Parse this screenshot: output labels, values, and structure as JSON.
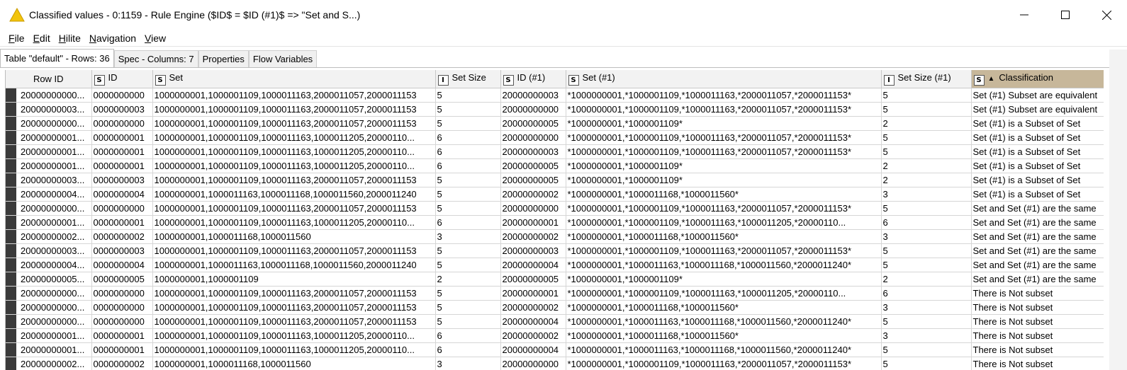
{
  "window": {
    "title": "Classified values - 0:1159 - Rule Engine ($ID$ = $ID (#1)$ => \"Set and S...)"
  },
  "menu": [
    "File",
    "Edit",
    "Hilite",
    "Navigation",
    "View"
  ],
  "tabs": [
    {
      "label": "Table \"default\" - Rows: 36",
      "active": true
    },
    {
      "label": "Spec - Columns: 7",
      "active": false
    },
    {
      "label": "Properties",
      "active": false
    },
    {
      "label": "Flow Variables",
      "active": false
    }
  ],
  "table": {
    "columns": [
      {
        "label": "Row ID",
        "type": ""
      },
      {
        "label": "ID",
        "type": "S"
      },
      {
        "label": "Set",
        "type": "S"
      },
      {
        "label": "Set Size",
        "type": "I"
      },
      {
        "label": "ID (#1)",
        "type": "S"
      },
      {
        "label": "Set (#1)",
        "type": "S"
      },
      {
        "label": "Set Size (#1)",
        "type": "I"
      },
      {
        "label": "Classification",
        "type": "S",
        "sorted": true
      }
    ],
    "rows": [
      [
        "20000000000...",
        "0000000000",
        "1000000001,1000001109,1000011163,2000011057,2000011153",
        "5",
        "20000000003",
        "*1000000001,*1000001109,*1000011163,*2000011057,*2000011153*",
        "5",
        "Set (#1) Subset are equivalent"
      ],
      [
        "20000000003...",
        "0000000003",
        "1000000001,1000001109,1000011163,2000011057,2000011153",
        "5",
        "20000000000",
        "*1000000001,*1000001109,*1000011163,*2000011057,*2000011153*",
        "5",
        "Set (#1) Subset are equivalent"
      ],
      [
        "20000000000...",
        "0000000000",
        "1000000001,1000001109,1000011163,2000011057,2000011153",
        "5",
        "20000000005",
        "*1000000001,*1000001109*",
        "2",
        "Set (#1) is a Subset of Set"
      ],
      [
        "20000000001...",
        "0000000001",
        "1000000001,1000001109,1000011163,1000011205,20000110...",
        "6",
        "20000000000",
        "*1000000001,*1000001109,*1000011163,*2000011057,*2000011153*",
        "5",
        "Set (#1) is a Subset of Set"
      ],
      [
        "20000000001...",
        "0000000001",
        "1000000001,1000001109,1000011163,1000011205,20000110...",
        "6",
        "20000000003",
        "*1000000001,*1000001109,*1000011163,*2000011057,*2000011153*",
        "5",
        "Set (#1) is a Subset of Set"
      ],
      [
        "20000000001...",
        "0000000001",
        "1000000001,1000001109,1000011163,1000011205,20000110...",
        "6",
        "20000000005",
        "*1000000001,*1000001109*",
        "2",
        "Set (#1) is a Subset of Set"
      ],
      [
        "20000000003...",
        "0000000003",
        "1000000001,1000001109,1000011163,2000011057,2000011153",
        "5",
        "20000000005",
        "*1000000001,*1000001109*",
        "2",
        "Set (#1) is a Subset of Set"
      ],
      [
        "20000000004...",
        "0000000004",
        "1000000001,1000011163,1000011168,1000011560,2000011240",
        "5",
        "20000000002",
        "*1000000001,*1000011168,*1000011560*",
        "3",
        "Set (#1) is a Subset of Set"
      ],
      [
        "20000000000...",
        "0000000000",
        "1000000001,1000001109,1000011163,2000011057,2000011153",
        "5",
        "20000000000",
        "*1000000001,*1000001109,*1000011163,*2000011057,*2000011153*",
        "5",
        "Set and Set (#1) are the same"
      ],
      [
        "20000000001...",
        "0000000001",
        "1000000001,1000001109,1000011163,1000011205,20000110...",
        "6",
        "20000000001",
        "*1000000001,*1000001109,*1000011163,*1000011205,*20000110...",
        "6",
        "Set and Set (#1) are the same"
      ],
      [
        "20000000002...",
        "0000000002",
        "1000000001,1000011168,1000011560",
        "3",
        "20000000002",
        "*1000000001,*1000011168,*1000011560*",
        "3",
        "Set and Set (#1) are the same"
      ],
      [
        "20000000003...",
        "0000000003",
        "1000000001,1000001109,1000011163,2000011057,2000011153",
        "5",
        "20000000003",
        "*1000000001,*1000001109,*1000011163,*2000011057,*2000011153*",
        "5",
        "Set and Set (#1) are the same"
      ],
      [
        "20000000004...",
        "0000000004",
        "1000000001,1000011163,1000011168,1000011560,2000011240",
        "5",
        "20000000004",
        "*1000000001,*1000011163,*1000011168,*1000011560,*2000011240*",
        "5",
        "Set and Set (#1) are the same"
      ],
      [
        "20000000005...",
        "0000000005",
        "1000000001,1000001109",
        "2",
        "20000000005",
        "*1000000001,*1000001109*",
        "2",
        "Set and Set (#1) are the same"
      ],
      [
        "20000000000...",
        "0000000000",
        "1000000001,1000001109,1000011163,2000011057,2000011153",
        "5",
        "20000000001",
        "*1000000001,*1000001109,*1000011163,*1000011205,*20000110...",
        "6",
        "There is Not subset"
      ],
      [
        "20000000000...",
        "0000000000",
        "1000000001,1000001109,1000011163,2000011057,2000011153",
        "5",
        "20000000002",
        "*1000000001,*1000011168,*1000011560*",
        "3",
        "There is Not subset"
      ],
      [
        "20000000000...",
        "0000000000",
        "1000000001,1000001109,1000011163,2000011057,2000011153",
        "5",
        "20000000004",
        "*1000000001,*1000011163,*1000011168,*1000011560,*2000011240*",
        "5",
        "There is Not subset"
      ],
      [
        "20000000001...",
        "0000000001",
        "1000000001,1000001109,1000011163,1000011205,20000110...",
        "6",
        "20000000002",
        "*1000000001,*1000011168,*1000011560*",
        "3",
        "There is Not subset"
      ],
      [
        "20000000001...",
        "0000000001",
        "1000000001,1000001109,1000011163,1000011205,20000110...",
        "6",
        "20000000004",
        "*1000000001,*1000011163,*1000011168,*1000011560,*2000011240*",
        "5",
        "There is Not subset"
      ],
      [
        "20000000002...",
        "0000000002",
        "1000000001,1000011168,1000011560",
        "3",
        "20000000000",
        "*1000000001,*1000001109,*1000011163,*2000011057,*2000011153*",
        "5",
        "There is Not subset"
      ]
    ]
  },
  "colors": {
    "sorted_header": "#c7b79a",
    "hilite_bar": "#3a3a3a",
    "warning_icon": "#f2c40c"
  }
}
